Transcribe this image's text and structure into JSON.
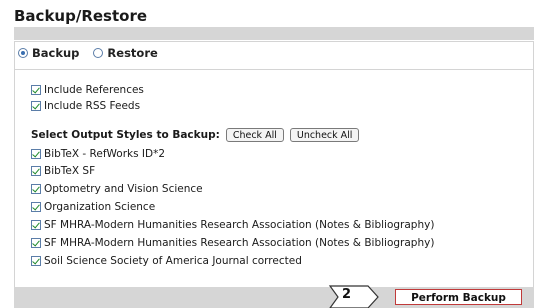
{
  "page": {
    "title": "Backup/Restore"
  },
  "mode": {
    "options": [
      {
        "label": "Backup",
        "selected": true
      },
      {
        "label": "Restore",
        "selected": false
      }
    ]
  },
  "include_options": [
    {
      "label": "Include References",
      "checked": true
    },
    {
      "label": "Include RSS Feeds",
      "checked": true
    }
  ],
  "styles": {
    "header": "Select Output Styles to Backup:",
    "check_all_label": "Check All",
    "uncheck_all_label": "Uncheck All",
    "items": [
      {
        "label": "BibTeX - RefWorks ID*2",
        "checked": true
      },
      {
        "label": "BibTeX SF",
        "checked": true
      },
      {
        "label": "Optometry and Vision Science",
        "checked": true
      },
      {
        "label": "Organization Science",
        "checked": true
      },
      {
        "label": "SF MHRA-Modern Humanities Research Association (Notes & Bibliography)",
        "checked": true
      },
      {
        "label": "SF MHRA-Modern Humanities Research Association (Notes & Bibliography)",
        "checked": true
      },
      {
        "label": "Soil Science Society of America Journal corrected",
        "checked": true
      }
    ]
  },
  "footer": {
    "step_number": "2",
    "perform_label": "Perform Backup"
  },
  "colors": {
    "band": "#d6d6d6",
    "checkmark": "#1e8a2a",
    "perform_border": "#c03a3a"
  }
}
